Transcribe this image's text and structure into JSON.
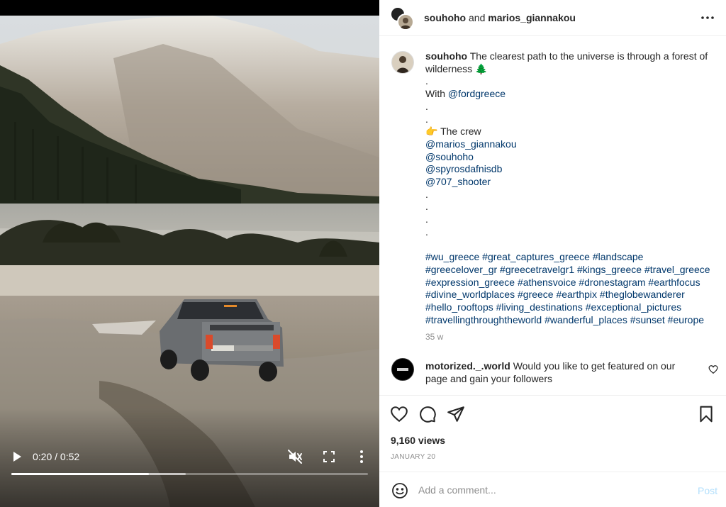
{
  "video": {
    "time_label": "0:20 / 0:52",
    "played_fraction": 0.385,
    "buffered_fraction": 0.49
  },
  "header": {
    "user1": "souhoho",
    "joiner": "and",
    "user2": "marios_giannakou"
  },
  "caption": {
    "username": "souhoho",
    "lines": [
      {
        "text": "The clearest path to the universe is through a forest of wilderness 🌲",
        "kind": "text"
      },
      {
        "text": ".",
        "kind": "text"
      },
      {
        "prefix": "With ",
        "text": "@fordgreece",
        "kind": "mention"
      },
      {
        "text": ".",
        "kind": "text"
      },
      {
        "text": ".",
        "kind": "text"
      },
      {
        "text": "👉 The crew",
        "kind": "text"
      },
      {
        "text": "@marios_giannakou",
        "kind": "mention"
      },
      {
        "text": "@souhoho",
        "kind": "mention"
      },
      {
        "text": "@spyrosdafnisdb",
        "kind": "mention"
      },
      {
        "text": "@707_shooter",
        "kind": "mention"
      },
      {
        "text": ".",
        "kind": "text"
      },
      {
        "text": ".",
        "kind": "text"
      },
      {
        "text": ".",
        "kind": "text"
      },
      {
        "text": ".",
        "kind": "text"
      },
      {
        "text": "",
        "kind": "text"
      },
      {
        "text": "#wu_greece #great_captures_greece #landscape #greecelover_gr #greecetravelgr1 #kings_greece #travel_greece #expression_greece #athensvoice #dronestagram #earthfocus #divine_worldplaces #greece #earthpix #theglobewanderer #hello_rooftops #living_destinations #exceptional_pictures #travellingthroughtheworld #wanderful_places #sunset #europe",
        "kind": "tags"
      }
    ],
    "time": "35 w"
  },
  "comment": {
    "username": "motorized._.world",
    "text": "Would you like to get featured on our page and gain your followers"
  },
  "actions": {
    "views": "9,160 views",
    "date": "JANUARY 20"
  },
  "add_comment": {
    "placeholder": "Add a comment...",
    "post_label": "Post"
  },
  "colors": {
    "link": "#00376b",
    "post_disabled": "#b2dffc",
    "meta": "#8e8e8e"
  },
  "icons": [
    "play-icon",
    "mute-icon",
    "fullscreen-icon",
    "more-vertical-icon",
    "more-horizontal-icon",
    "heart-icon",
    "comment-icon",
    "share-icon",
    "bookmark-icon",
    "emoji-icon"
  ]
}
